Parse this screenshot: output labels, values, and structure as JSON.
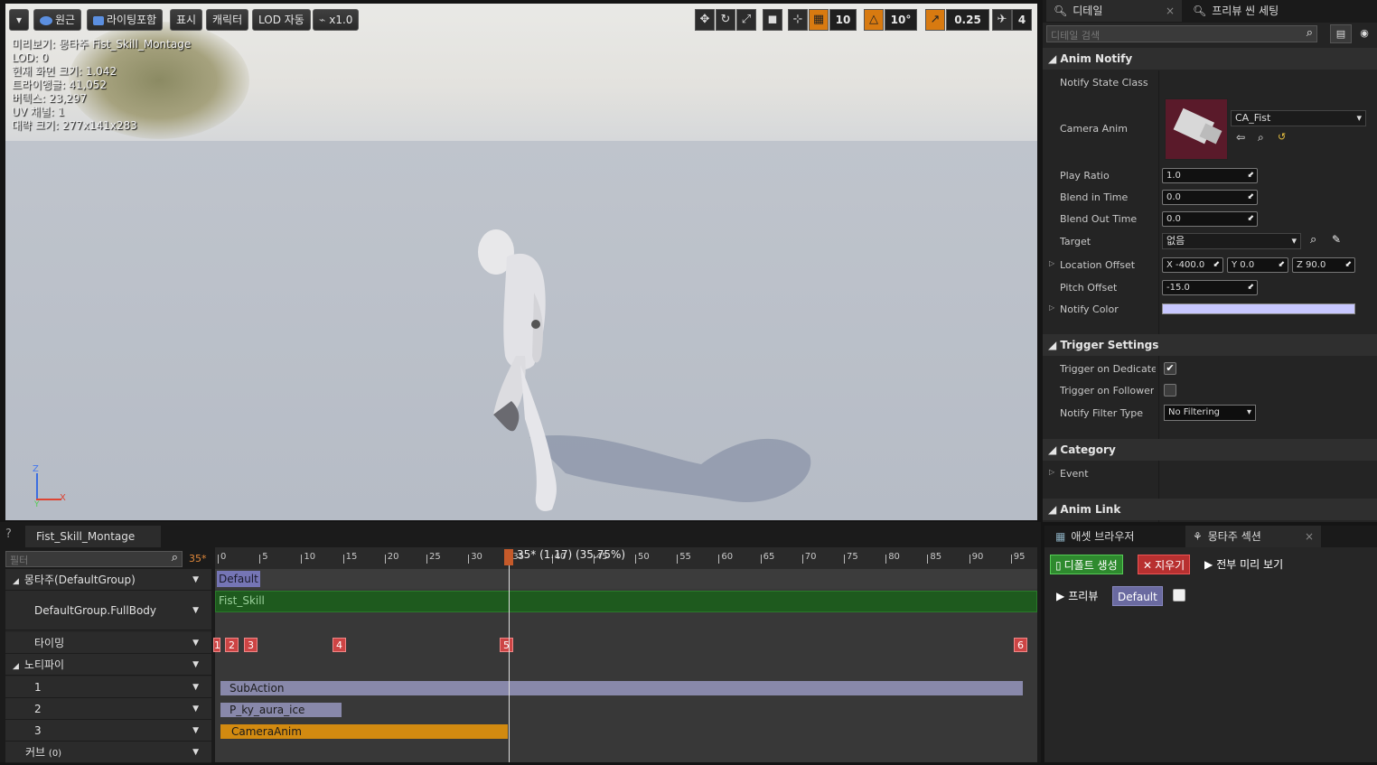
{
  "viewport": {
    "toolbar": {
      "perspective": "원근",
      "lighting": "라이팅포함",
      "show": "표시",
      "character": "캐릭터",
      "lod": "LOD 자동",
      "speed": "x1.0",
      "grid_snap": "10",
      "rot_snap": "10°",
      "scale_snap": "0.25",
      "cam_speed": "4"
    },
    "stats": [
      "미리보기: 몽타주 Fist_Skill_Montage",
      "LOD: 0",
      "현재 화면 크기: 1.042",
      "트라이앵글: 41,052",
      "버텍스: 23,297",
      "UV 채널: 1",
      "대략 크기: 277x141x283"
    ],
    "axes": {
      "z": "Z",
      "y": "Y",
      "x": "X"
    }
  },
  "details": {
    "tabs": [
      "디테일",
      "프리뷰 씬 세팅"
    ],
    "search_placeholder": "디테일 검색",
    "sections": {
      "anim_notify": "Anim Notify",
      "trigger": "Trigger Settings",
      "category": "Category",
      "anim_link": "Anim Link"
    },
    "labels": {
      "notify_state_class": "Notify State Class",
      "camera_anim": "Camera Anim",
      "play_ratio": "Play Ratio",
      "blend_in": "Blend in Time",
      "blend_out": "Blend Out Time",
      "target": "Target",
      "location_offset": "Location Offset",
      "pitch_offset": "Pitch Offset",
      "notify_color": "Notify Color",
      "trigger_dedicated": "Trigger on Dedicated Server",
      "trigger_follower": "Trigger on Follower",
      "notify_filter": "Notify Filter Type",
      "event": "Event"
    },
    "values": {
      "camera_anim_asset": "CA_Fist",
      "play_ratio": "1.0",
      "blend_in": "0.0",
      "blend_out": "0.0",
      "target": "없음",
      "loc_x_label": "X",
      "loc_x": "-400.0",
      "loc_y_label": "Y",
      "loc_y": "0.0",
      "loc_z_label": "Z",
      "loc_z": "90.0",
      "pitch_offset": "-15.0",
      "notify_color": "#c8c8ff",
      "trigger_dedicated_checked": true,
      "trigger_follower_checked": false,
      "notify_filter": "No Filtering"
    }
  },
  "timeline": {
    "tab": "Fist_Skill_Montage",
    "filter_placeholder": "필터",
    "current_frame": "35*",
    "playhead_label": "35* (1.17) (35.75%)",
    "ticks": [
      "0",
      "5",
      "10",
      "15",
      "20",
      "25",
      "30",
      "35",
      "40",
      "45",
      "50",
      "55",
      "60",
      "65",
      "70",
      "75",
      "80",
      "85",
      "90",
      "95"
    ],
    "tracks": {
      "montage": "몽타주(DefaultGroup)",
      "slot": "DefaultGroup.FullBody",
      "timing": "타이밍",
      "notifies": "노티파이",
      "n1": "1",
      "n2": "2",
      "n3": "3",
      "curves": "커브",
      "curves_count": "(0)"
    },
    "section_default": "Default",
    "segment": "Fist_Skill",
    "markers": [
      "1",
      "2",
      "3",
      "4",
      "5",
      "6"
    ],
    "notifies": [
      "SubAction",
      "P_ky_aura_ice",
      "CameraAnim"
    ]
  },
  "montage_panel": {
    "tabs": [
      "애셋 브라우저",
      "몽타주 섹션"
    ],
    "create_default": "디폴트 생성",
    "clear": "지우기",
    "preview_all": "전부 미리 보기",
    "preview": "프리뷰",
    "section": "Default"
  }
}
